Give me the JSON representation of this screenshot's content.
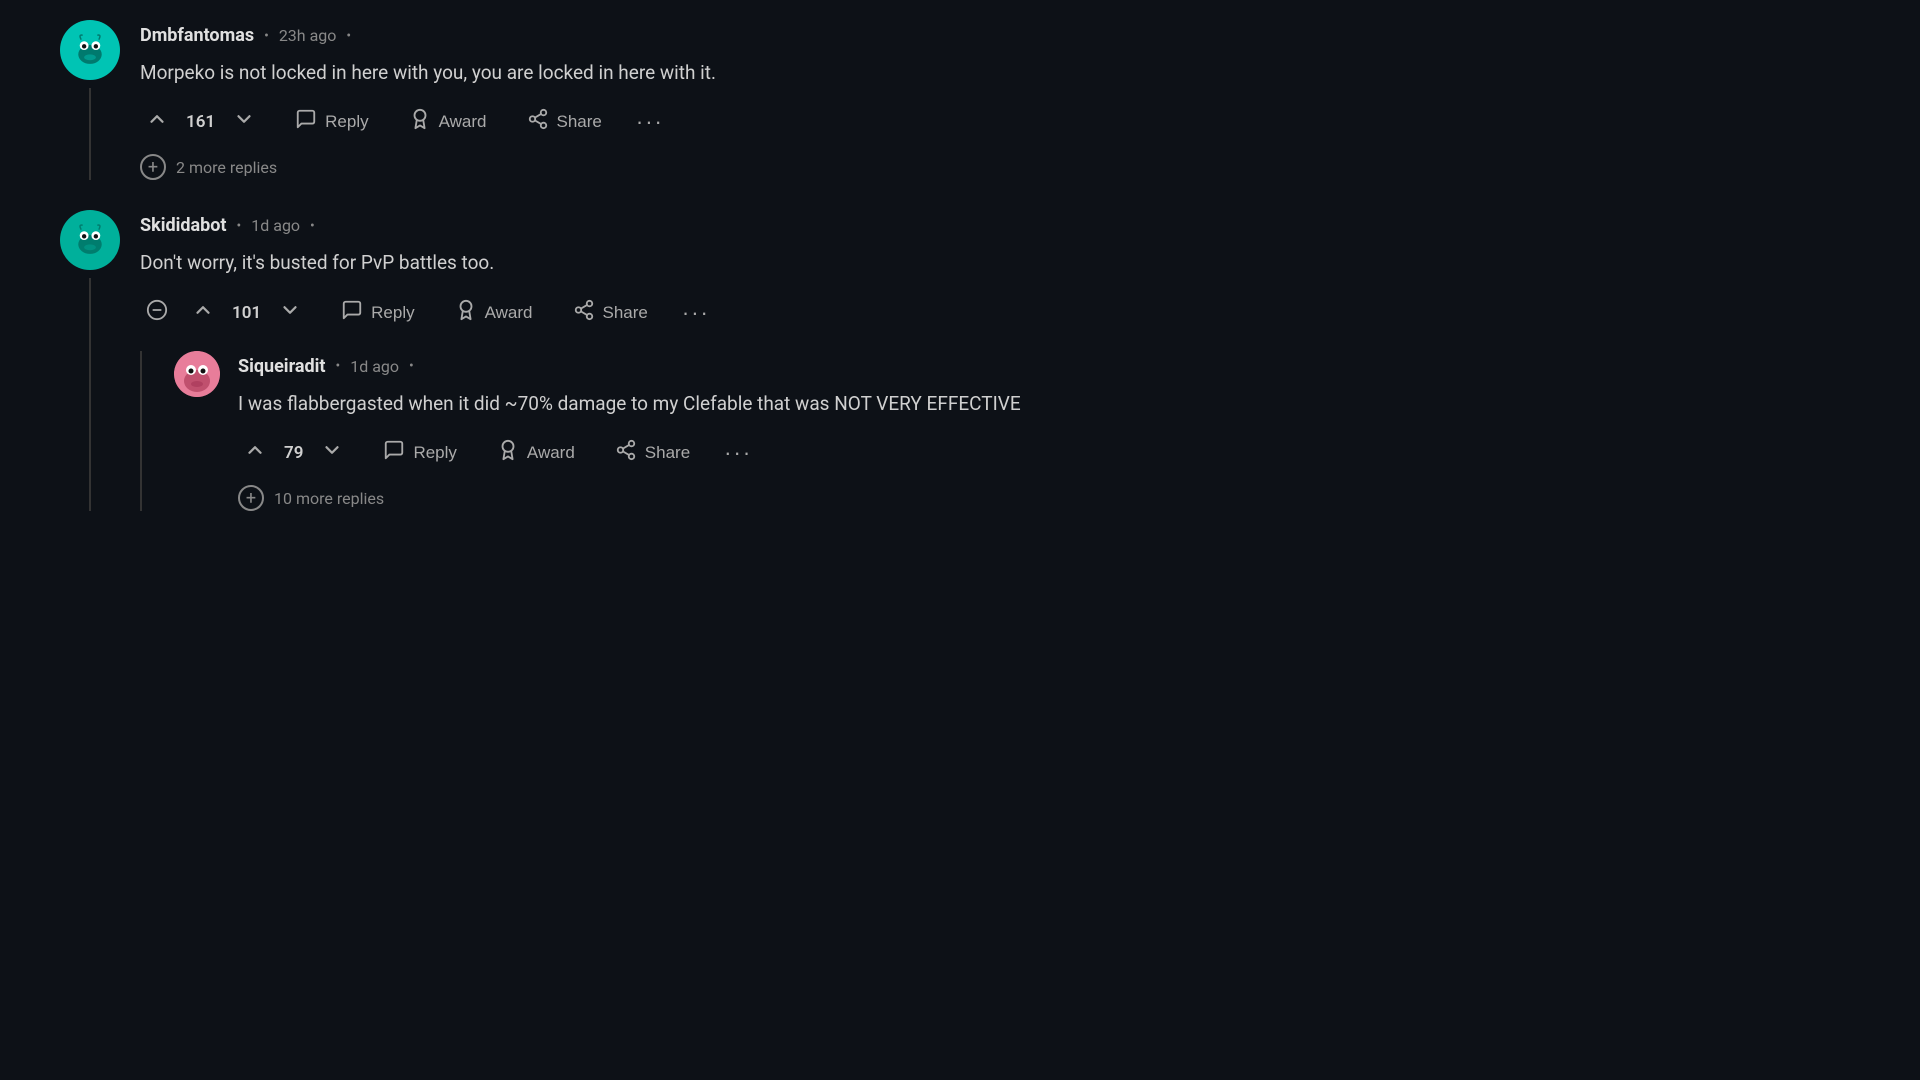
{
  "comments": [
    {
      "id": "comment1",
      "username": "Dmbfantomas",
      "timestamp": "23h ago",
      "text": "Morpeko is not locked in here with you, you are locked in here with it.",
      "votes": 161,
      "moreReplies": "2 more replies",
      "avatarColor": "#00c4b4"
    },
    {
      "id": "comment2",
      "username": "Skididabot",
      "timestamp": "1d ago",
      "text": "Don't worry, it's busted for PvP battles too.",
      "votes": 101,
      "avatarColor": "#00b09b",
      "replies": [
        {
          "id": "reply1",
          "username": "Siqueiradit",
          "timestamp": "1d ago",
          "text": "I was flabbergasted when it did ~70% damage to my Clefable that was NOT VERY EFFECTIVE",
          "votes": 79,
          "moreReplies": "10 more replies",
          "avatarColor": "#e87d9a"
        }
      ]
    }
  ],
  "actions": {
    "reply": "Reply",
    "award": "Award",
    "share": "Share"
  }
}
